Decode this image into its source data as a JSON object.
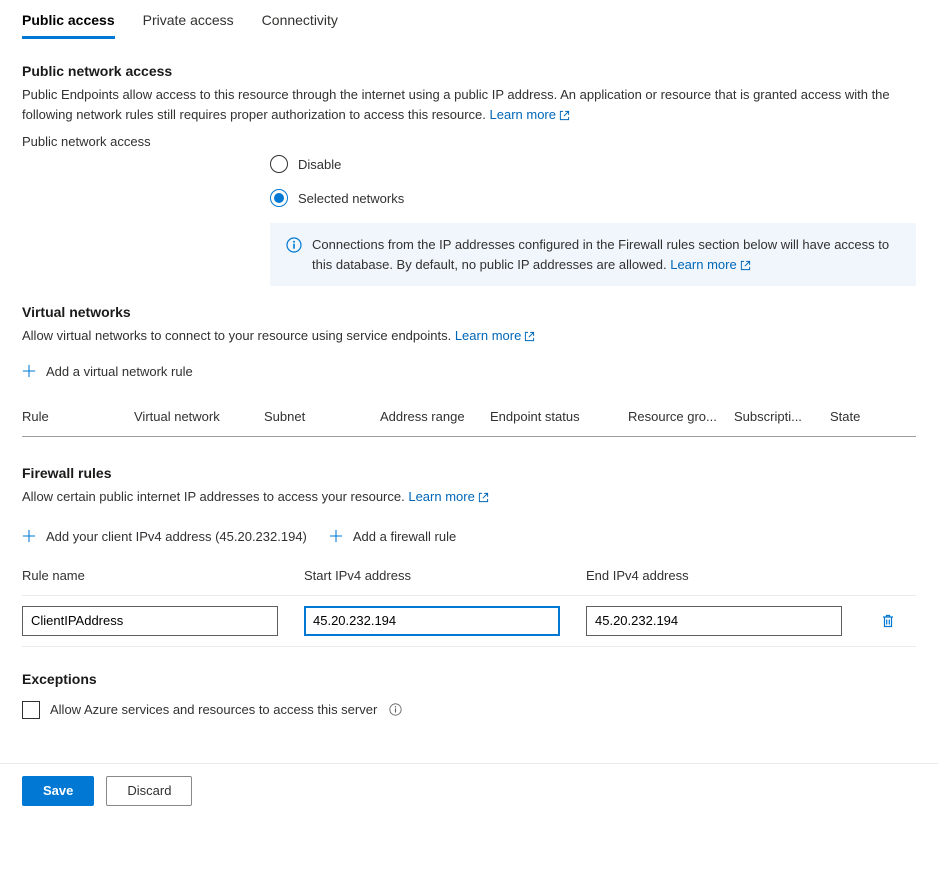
{
  "tabs": {
    "public": "Public access",
    "private": "Private access",
    "connectivity": "Connectivity"
  },
  "public_access": {
    "heading": "Public network access",
    "desc_1": "Public Endpoints allow access to this resource through the internet using a public IP address. An application or resource that is granted access with the following network rules still requires proper authorization to access this resource. ",
    "learn_more": "Learn more",
    "field_label": "Public network access",
    "option_disable": "Disable",
    "option_selected": "Selected networks",
    "info_text": "Connections from the IP addresses configured in the Firewall rules section below will have access to this database. By default, no public IP addresses are allowed.  ",
    "info_learn_more": "Learn more"
  },
  "vnet": {
    "heading": "Virtual networks",
    "desc": "Allow virtual networks to connect to your resource using service endpoints. ",
    "learn_more": "Learn more",
    "add_rule": "Add a virtual network rule",
    "cols": {
      "rule": "Rule",
      "vn": "Virtual network",
      "subnet": "Subnet",
      "addr": "Address range",
      "endpoint": "Endpoint status",
      "rg": "Resource gro...",
      "sub": "Subscripti...",
      "state": "State"
    }
  },
  "firewall": {
    "heading": "Firewall rules",
    "desc": "Allow certain public internet IP addresses to access your resource. ",
    "learn_more": "Learn more",
    "add_client": "Add your client IPv4 address (45.20.232.194)",
    "add_rule": "Add a firewall rule",
    "cols": {
      "name": "Rule name",
      "start": "Start IPv4 address",
      "end": "End IPv4 address"
    },
    "row": {
      "name": "ClientIPAddress",
      "start": "45.20.232.194",
      "end": "45.20.232.194"
    }
  },
  "exceptions": {
    "heading": "Exceptions",
    "allow_azure": "Allow Azure services and resources to access this server"
  },
  "footer": {
    "save": "Save",
    "discard": "Discard"
  }
}
